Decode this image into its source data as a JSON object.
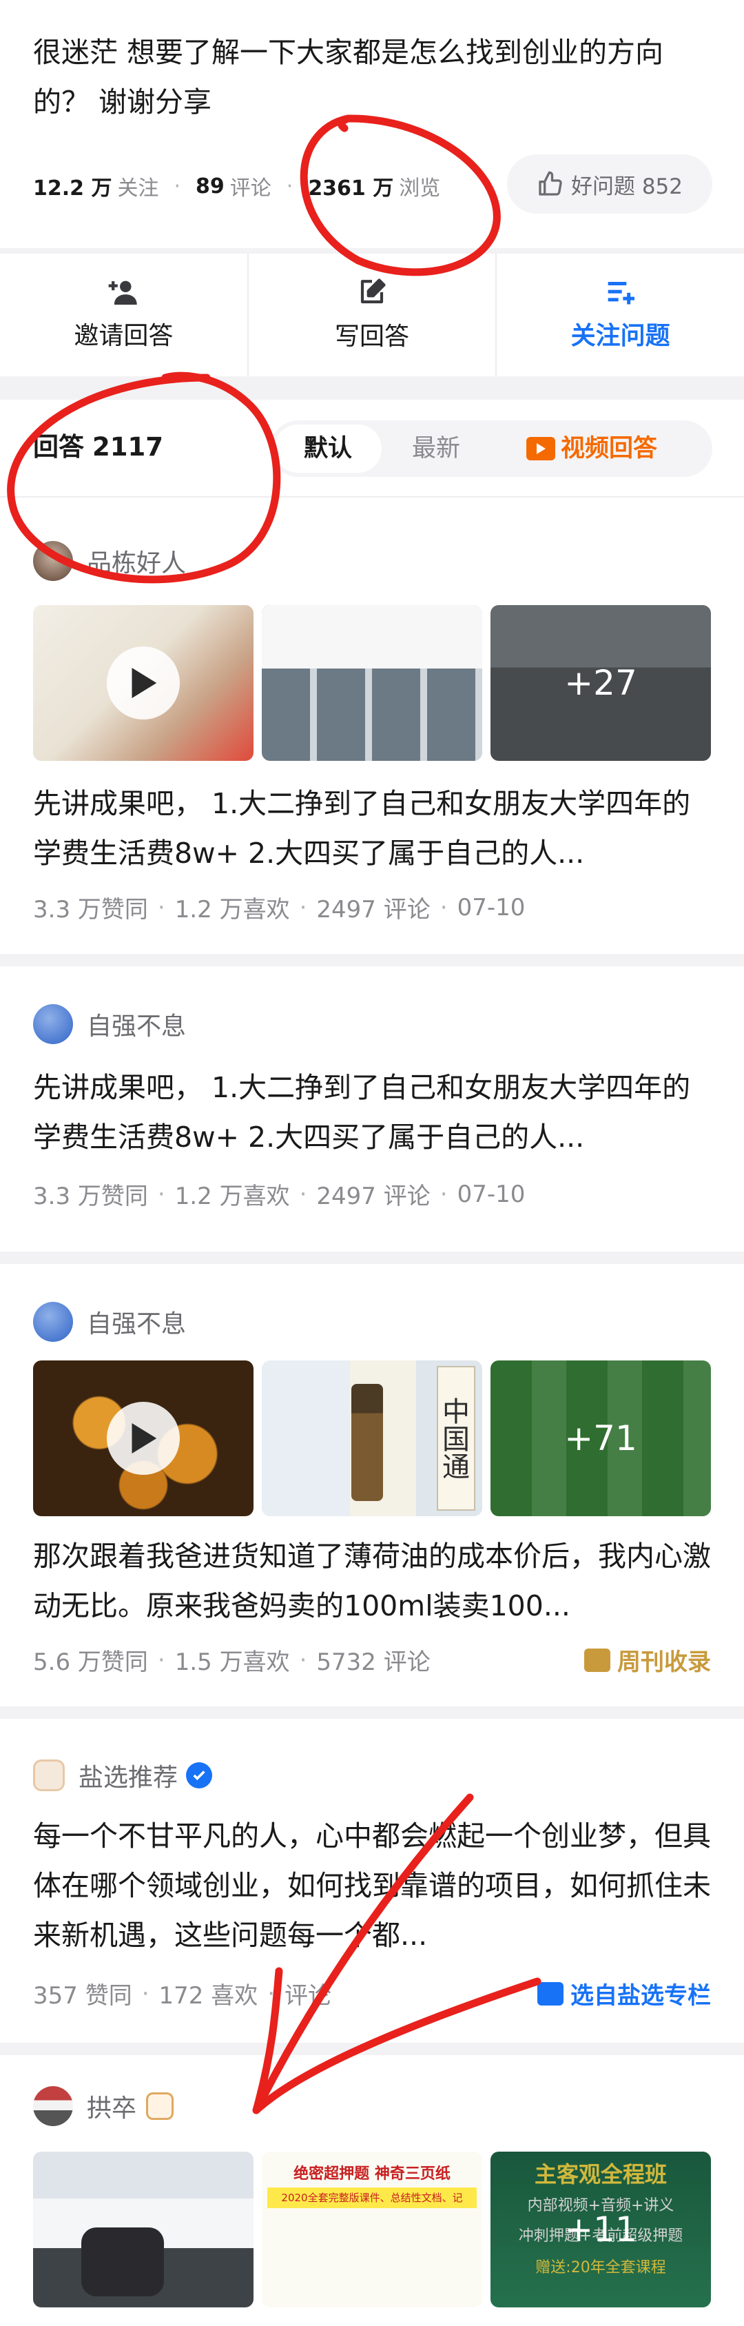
{
  "question": {
    "title": "很迷茫 想要了解一下大家都是怎么找到创业的方向的？ 谢谢分享",
    "follow_count": "12.2 万",
    "follow_label": "关注",
    "comment_count": "89",
    "comment_label": "评论",
    "view_count": "2361 万",
    "view_label": "浏览",
    "good_question_label": "好问题 852"
  },
  "actions": [
    {
      "label": "邀请回答",
      "icon": "invite-user-icon"
    },
    {
      "label": "写回答",
      "icon": "edit-icon"
    },
    {
      "label": "关注问题",
      "icon": "follow-list-icon"
    }
  ],
  "answers_header": {
    "label": "回答",
    "count": "2117",
    "tabs": [
      "默认",
      "最新"
    ],
    "video_tab": "视频回答"
  },
  "answers": [
    {
      "author": "品栋好人",
      "excerpt": "先讲成果吧， 1.大二挣到了自己和女朋友大学四年的学费生活费8w+ 2.大四买了属于自己的人...",
      "likes": "3.3 万赞同",
      "favs": "1.2 万喜欢",
      "comments": "2497 评论",
      "date": "07-10",
      "more_images": "+27"
    },
    {
      "author": "自强不息",
      "excerpt": "先讲成果吧， 1.大二挣到了自己和女朋友大学四年的学费生活费8w+ 2.大四买了属于自己的人...",
      "likes": "3.3 万赞同",
      "favs": "1.2 万喜欢",
      "comments": "2497 评论",
      "date": "07-10"
    },
    {
      "author": "自强不息",
      "excerpt": "那次跟着我爸进货知道了薄荷油的成本价后，我内心激动无比。原来我爸妈卖的100ml装卖100...",
      "likes": "5.6 万赞同",
      "favs": "1.5 万喜欢",
      "comments": "5732 评论",
      "tag": "周刊收录",
      "more_images": "+71",
      "thumb_text": "中国通"
    },
    {
      "author": "盐选推荐",
      "excerpt": "每一个不甘平凡的人，心中都会燃起一个创业梦，但具体在哪个领域创业，如何找到靠谱的项目，如何抓住未来新机遇，这些问题每一个都...",
      "likes": "357 赞同",
      "favs": "172 喜欢",
      "comments": "评论",
      "tag": "选自盐选专栏"
    },
    {
      "author": "拱卒",
      "more_images": "+11",
      "thumb_title": "绝密超押题 神奇三页纸",
      "thumb_sub": "2020全套完整版课件、总结性文档、记",
      "thumb_text_1": "主客观全程班",
      "thumb_text_2": "内部视频+音频+讲义",
      "thumb_text_3": "冲刺押题+考前超级押题",
      "thumb_text_4": "赠送:20年全套课程"
    }
  ],
  "colors": {
    "accent_blue": "#1772f6",
    "video_orange": "#f56a00",
    "tag_gold": "#c89a3c",
    "annotation_red": "#e8211c"
  }
}
